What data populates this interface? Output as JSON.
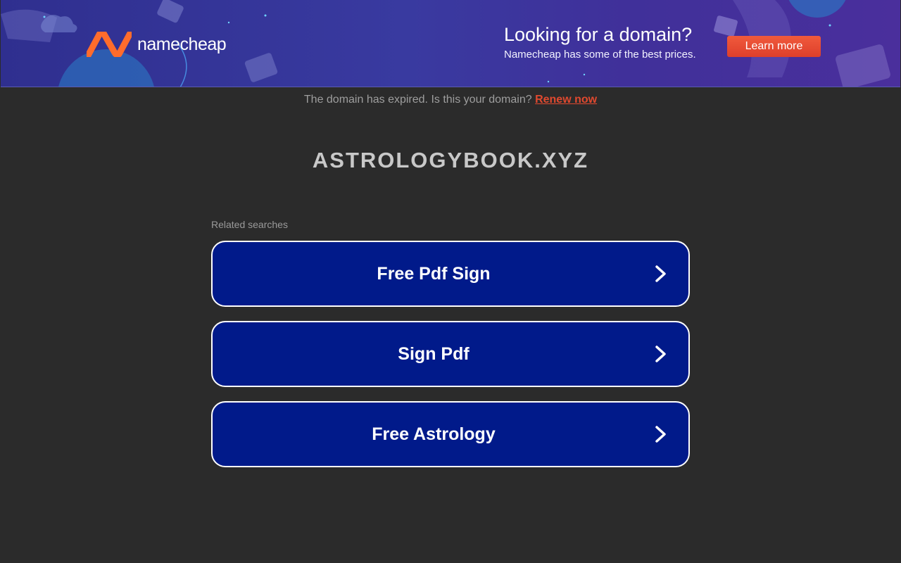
{
  "banner": {
    "brand": "namecheap",
    "headline": "Looking for a domain?",
    "subline": "Namecheap has some of the best prices.",
    "cta_label": "Learn more",
    "colors": {
      "brand_orange": "#ff6c2c",
      "cta_red": "#e24a2f",
      "banner_blue": "#3a3aa0"
    }
  },
  "notice": {
    "text": "The domain has expired. Is this your domain?",
    "link_label": "Renew now"
  },
  "domain": "ASTROLOGYBOOK.XYZ",
  "related": {
    "label": "Related searches",
    "items": [
      {
        "label": "Free Pdf Sign",
        "icon": "chevron-right-icon"
      },
      {
        "label": "Sign Pdf",
        "icon": "chevron-right-icon"
      },
      {
        "label": "Free Astrology",
        "icon": "chevron-right-icon"
      }
    ]
  },
  "colors": {
    "page_bg": "#2b2b2b",
    "item_bg": "#011a8a",
    "link_red": "#e0492f"
  }
}
